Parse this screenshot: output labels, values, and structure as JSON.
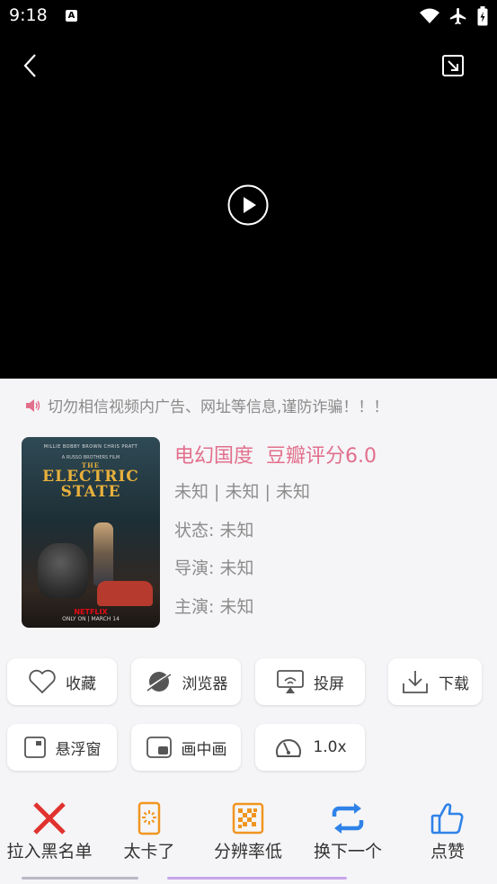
{
  "status_bar": {
    "time": "9:18",
    "notification_icon": "A"
  },
  "notice": {
    "text": "切勿相信视频内广告、网址等信息,谨防诈骗！！！"
  },
  "poster": {
    "credit_line": "MILLIE BOBBY BROWN   CHRIS PRATT",
    "subtitle": "A RUSSO BROTHERS FILM",
    "title_line1": "THE",
    "title_line2": "ELECTRIC",
    "title_line3": "STATE",
    "network": "NETFLIX",
    "release": "ONLY ON   |   MARCH 14"
  },
  "movie": {
    "genre": "电幻国度",
    "rating": "豆瓣评分6.0",
    "meta": "未知 | 未知 | 未知",
    "status": "状态: 未知",
    "director": "导演: 未知",
    "cast": "主演: 未知"
  },
  "actions": {
    "favorite": "收藏",
    "browser": "浏览器",
    "cast": "投屏",
    "download": "下载",
    "float": "悬浮窗",
    "pip": "画中画",
    "speed": "1.0x"
  },
  "bottom_actions": {
    "blacklist": "拉入黑名单",
    "lag": "太卡了",
    "resolution": "分辨率低",
    "next": "换下一个",
    "like": "点赞"
  },
  "colors": {
    "accent_pink": "#e26f8c",
    "red": "#e0322e",
    "orange": "#f0951f",
    "blue": "#2f82e8"
  }
}
